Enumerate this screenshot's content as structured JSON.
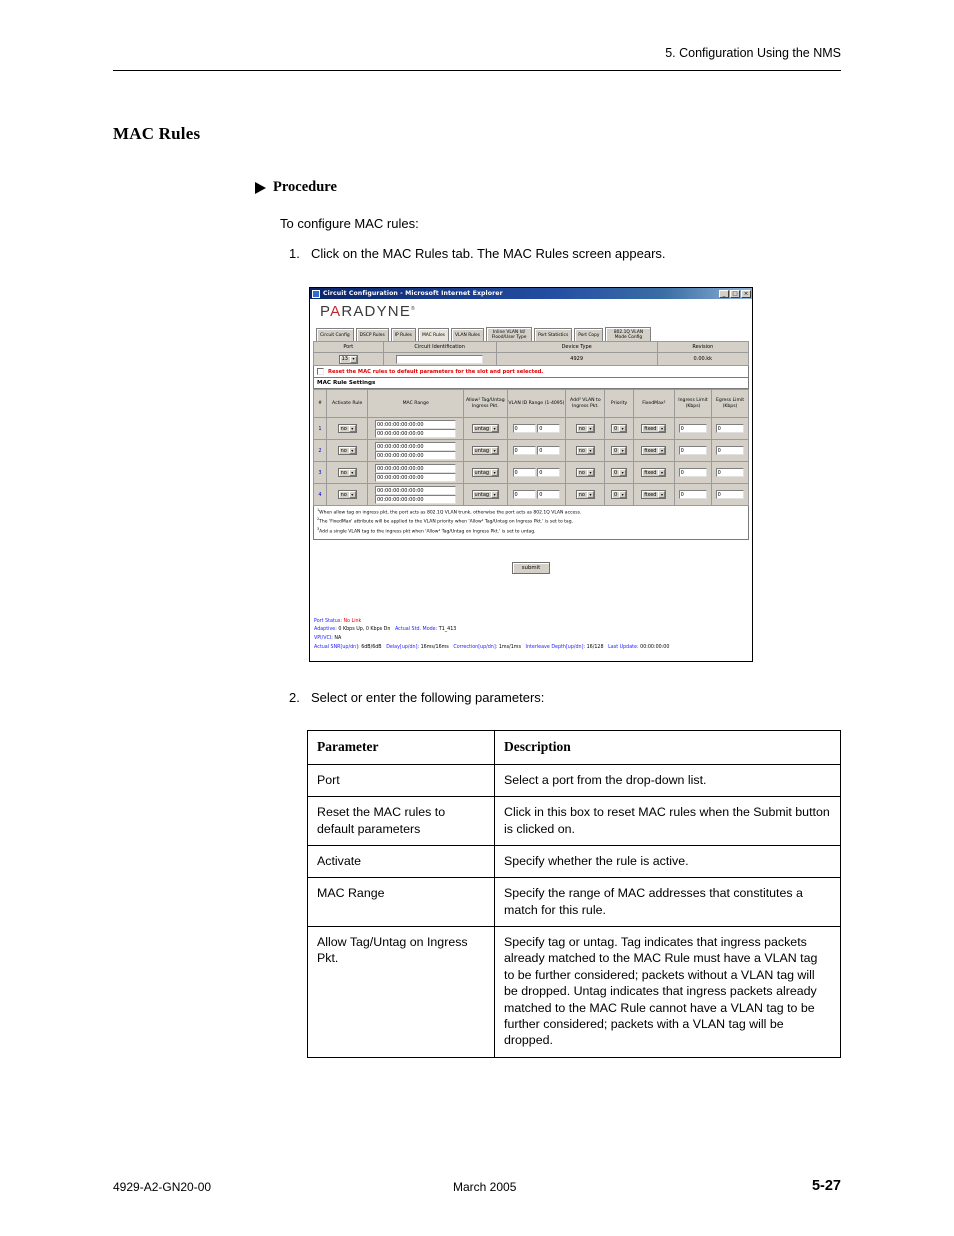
{
  "page": {
    "running_head": "5. Configuration Using the NMS",
    "section_title": "MAC Rules",
    "procedure_label": "Procedure",
    "lead_in": "To configure MAC rules:",
    "step1_num": "1.",
    "step1_text": "Click on the MAC Rules tab. The MAC Rules screen appears.",
    "step2_num": "2.",
    "step2_text": "Select or enter the following parameters:",
    "footer_doc_id": "4929-A2-GN20-00",
    "footer_date": "March 2005",
    "footer_page": "5-27"
  },
  "param_table": {
    "headers": [
      "Parameter",
      "Description"
    ],
    "rows": [
      {
        "parameter": "Port",
        "description": "Select a port from the drop-down list."
      },
      {
        "parameter": "Reset the MAC rules to default parameters",
        "description": "Click in this box to reset MAC rules when the Submit button is clicked on."
      },
      {
        "parameter": "Activate",
        "description": "Specify whether the rule is active."
      },
      {
        "parameter": "MAC Range",
        "description": "Specify the range of MAC addresses that constitutes a match for this rule."
      },
      {
        "parameter": "Allow Tag/Untag on Ingress Pkt.",
        "description": "Specify tag or untag. Tag indicates that ingress packets already matched to the MAC Rule must have a VLAN tag to be further considered; packets without a VLAN tag will be dropped. Untag indicates that ingress packets already matched to the MAC Rule cannot have a VLAN tag to be further considered; packets with a VLAN tag will be dropped."
      }
    ]
  },
  "screenshot": {
    "window_title": "Circuit Configuration - Microsoft Internet Explorer",
    "window_buttons": [
      "_",
      "□",
      "×"
    ],
    "brand": {
      "prefix": "P",
      "accent": "A",
      "suffix": "RADYNE",
      "trademark": "®"
    },
    "accent_color": "#c0272d",
    "tabs": [
      {
        "label": "Circuit Config",
        "selected": false
      },
      {
        "label": "DSCP Rules",
        "selected": false
      },
      {
        "label": "IP Rules",
        "selected": false
      },
      {
        "label": "MAC Rules",
        "selected": true
      },
      {
        "label": "VLAN Rules",
        "selected": false
      },
      {
        "label": "Inline VLAN Id/ Flood/User Type",
        "selected": false
      },
      {
        "label": "Port Statistics",
        "selected": false
      },
      {
        "label": "Port Copy",
        "selected": false
      },
      {
        "label": "802.1Q VLAN Mode Config",
        "selected": false
      }
    ],
    "info_row": {
      "headers": [
        "Port",
        "Circuit Identification",
        "Device Type",
        "Revision"
      ],
      "port_value": "13",
      "circuit_identification": "",
      "device_type": "4929",
      "revision": "0.00.kk"
    },
    "reset_checkbox": {
      "checked": false,
      "label": "Reset the MAC rules to default parameters for the slot and port selected."
    },
    "settings_title": "MAC Rule Settings",
    "rules_headers": [
      "#",
      "Activate Rule",
      "MAC Range",
      "Allow¹ Tag/Untag Ingress Pkt.",
      "VLAN ID Range (1-4095)",
      "Add³ VLAN to Ingress Pkt.",
      "Priority",
      "FixedMax²",
      "Ingress Limit (Kbps)",
      "Egress Limit (Kbps)"
    ],
    "rules_rows": [
      {
        "index": "1",
        "activate": "no",
        "mac_start": "00:00:00:00:00:00",
        "mac_end": "00:00:00:00:00:00",
        "allow": "untag",
        "vlan_low": "0",
        "vlan_high": "0",
        "add_vlan": "no",
        "priority": "0",
        "fixedmax": "fixed",
        "ingress_limit": "0",
        "egress_limit": "0"
      },
      {
        "index": "2",
        "activate": "no",
        "mac_start": "00:00:00:00:00:00",
        "mac_end": "00:00:00:00:00:00",
        "allow": "untag",
        "vlan_low": "0",
        "vlan_high": "0",
        "add_vlan": "no",
        "priority": "0",
        "fixedmax": "fixed",
        "ingress_limit": "0",
        "egress_limit": "0"
      },
      {
        "index": "3",
        "activate": "no",
        "mac_start": "00:00:00:00:00:00",
        "mac_end": "00:00:00:00:00:00",
        "allow": "untag",
        "vlan_low": "0",
        "vlan_high": "0",
        "add_vlan": "no",
        "priority": "0",
        "fixedmax": "fixed",
        "ingress_limit": "0",
        "egress_limit": "0"
      },
      {
        "index": "4",
        "activate": "no",
        "mac_start": "00:00:00:00:00:00",
        "mac_end": "00:00:00:00:00:00",
        "allow": "untag",
        "vlan_low": "0",
        "vlan_high": "0",
        "add_vlan": "no",
        "priority": "0",
        "fixedmax": "fixed",
        "ingress_limit": "0",
        "egress_limit": "0"
      }
    ],
    "footnotes": [
      "When allow tag on ingress pkt, the port acts as 802.1Q VLAN trunk, otherwise the port acts as 802.1Q VLAN access.",
      "The 'FixedMax' attribute will be applied to the VLAN priority when 'Allow¹ Tag/Untag on Ingress Pkt.' is set to tag.",
      "Add a single VLAN tag to the ingress pkt when 'Allow¹ Tag/Untag on Ingress Pkt.' is set to untag."
    ],
    "submit_label": "submit",
    "status": {
      "port_status_label": "Port Status:",
      "port_status_value": "No Link",
      "adaptive_label": "Adaptive:",
      "adaptive_value": "0 Kbps Up, 0 Kbps Dn",
      "std_mode_label": "Actual Std. Mode:",
      "std_mode_value": "T1_413",
      "vpivci_label": "VPI/VCI:",
      "vpivci_value": "NA",
      "snr_label": "Actual SNR[up/dn]:",
      "snr_value": "6dB/6dB",
      "delay_label": "Delay[up/dn]:",
      "delay_value": "16ms/16ms",
      "correction_label": "Correction[up/dn]:",
      "correction_value": "1ms/1ms",
      "interleave_label": "Interleave Depth[up/dn]:",
      "interleave_value": "16/128",
      "last_update_label": "Last Update:",
      "last_update_value": "00:00:00:00"
    }
  }
}
